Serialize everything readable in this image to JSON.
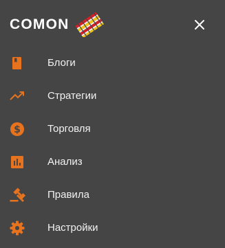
{
  "header": {
    "logo_text": "COMON",
    "logo_icon": "striped-flag-logo-icon",
    "close_icon": "close-icon"
  },
  "colors": {
    "background": "#454545",
    "accent": "#e8731f",
    "text": "#f2f2f2"
  },
  "menu": {
    "items": [
      {
        "label": "Блоги",
        "icon": "book-icon"
      },
      {
        "label": "Стратегии",
        "icon": "trending-up-icon"
      },
      {
        "label": "Торговля",
        "icon": "dollar-coin-icon"
      },
      {
        "label": "Анализ",
        "icon": "bar-chart-icon"
      },
      {
        "label": "Правила",
        "icon": "gavel-icon"
      },
      {
        "label": "Настройки",
        "icon": "gear-icon"
      }
    ]
  }
}
